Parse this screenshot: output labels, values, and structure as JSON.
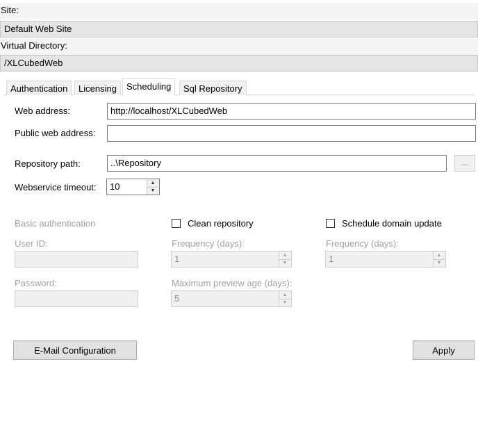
{
  "header": {
    "site_label": "Site:",
    "site_value": "Default Web Site",
    "vdir_label": "Virtual Directory:",
    "vdir_value": "/XLCubedWeb"
  },
  "tabs": [
    {
      "label": "Authentication",
      "active": false
    },
    {
      "label": "Licensing",
      "active": false
    },
    {
      "label": "Scheduling",
      "active": true
    },
    {
      "label": "Sql Repository",
      "active": false
    }
  ],
  "form": {
    "web_address_label": "Web address:",
    "web_address_value": "http://localhost/XLCubedWeb",
    "public_web_address_label": "Public web address:",
    "public_web_address_value": "",
    "repository_path_label": "Repository path:",
    "repository_path_value": "..\\Repository",
    "browse_label": "...",
    "timeout_label": "Webservice timeout:",
    "timeout_value": "10"
  },
  "basic_auth": {
    "label": "Basic authentication",
    "user_id_label": "User ID:",
    "user_id_value": "",
    "password_label": "Password:",
    "password_value": ""
  },
  "clean_repo": {
    "label": "Clean repository",
    "checked": false,
    "frequency_label": "Frequency (days):",
    "frequency_value": "1",
    "max_preview_label": "Maximum preview age (days):",
    "max_preview_value": "5"
  },
  "schedule_domain": {
    "label": "Schedule domain update",
    "checked": false,
    "frequency_label": "Frequency (days):",
    "frequency_value": "1"
  },
  "buttons": {
    "email_config": "E-Mail Configuration",
    "apply": "Apply"
  }
}
